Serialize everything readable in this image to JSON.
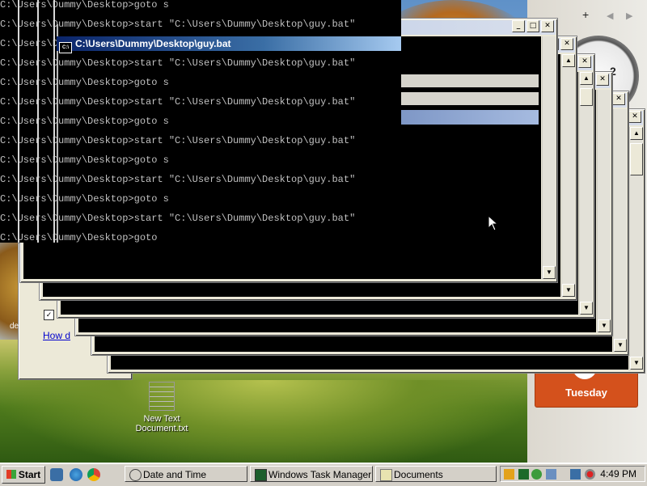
{
  "sidebar": {
    "add_glyph": "+",
    "prev_glyph": "◀",
    "next_glyph": "▶",
    "clock_numeral": "2",
    "calendar_day": "Tuesday"
  },
  "desktop_icon": {
    "label": "New Text Document.txt"
  },
  "dialog": {
    "link_text": "How d",
    "left_text": "de"
  },
  "front_window": {
    "title": "C:\\Users\\Dummy\\Desktop\\guy.bat",
    "icon_text": "C:\\"
  },
  "cmd_lines": [
    "C:\\Users\\Dummy\\Desktop>goto s",
    "C:\\Users\\Dummy\\Desktop>start \"C:\\Users\\Dummy\\Desktop\\guy.bat\"",
    "C:\\Users\\Dummy\\Desktop>start \"C:\\Users\\Dummy\\Desktop\\guy.bat\"",
    "C:\\Users\\Dummy\\Desktop>start \"C:\\Users\\Dummy\\Desktop\\guy.bat\"",
    "C:\\Users\\Dummy\\Desktop>goto s",
    "C:\\Users\\Dummy\\Desktop>start \"C:\\Users\\Dummy\\Desktop\\guy.bat\"",
    "C:\\Users\\Dummy\\Desktop>goto s",
    "C:\\Users\\Dummy\\Desktop>start \"C:\\Users\\Dummy\\Desktop\\guy.bat\"",
    "C:\\Users\\Dummy\\Desktop>goto s",
    "C:\\Users\\Dummy\\Desktop>start \"C:\\Users\\Dummy\\Desktop\\guy.bat\"",
    "C:\\Users\\Dummy\\Desktop>goto s",
    "C:\\Users\\Dummy\\Desktop>start \"C:\\Users\\Dummy\\Desktop\\guy.bat\"",
    "C:\\Users\\Dummy\\Desktop>goto"
  ],
  "window_buttons": {
    "minimize": "_",
    "maximize": "□",
    "close": "✕",
    "scroll_up": "▲",
    "scroll_down": "▼"
  },
  "taskbar": {
    "start_label": "Start",
    "tasks": [
      {
        "label": "Date and Time",
        "icon": "clock-icon"
      },
      {
        "label": "Windows Task Manager",
        "icon": "task-manager-icon"
      },
      {
        "label": "Documents",
        "icon": "folder-icon"
      }
    ],
    "clock": "4:49 PM"
  },
  "colors": {
    "titlebar_active": "#0a246a",
    "titlebar_inactive": "#a6bbe0",
    "calendar": "#d4511c"
  }
}
